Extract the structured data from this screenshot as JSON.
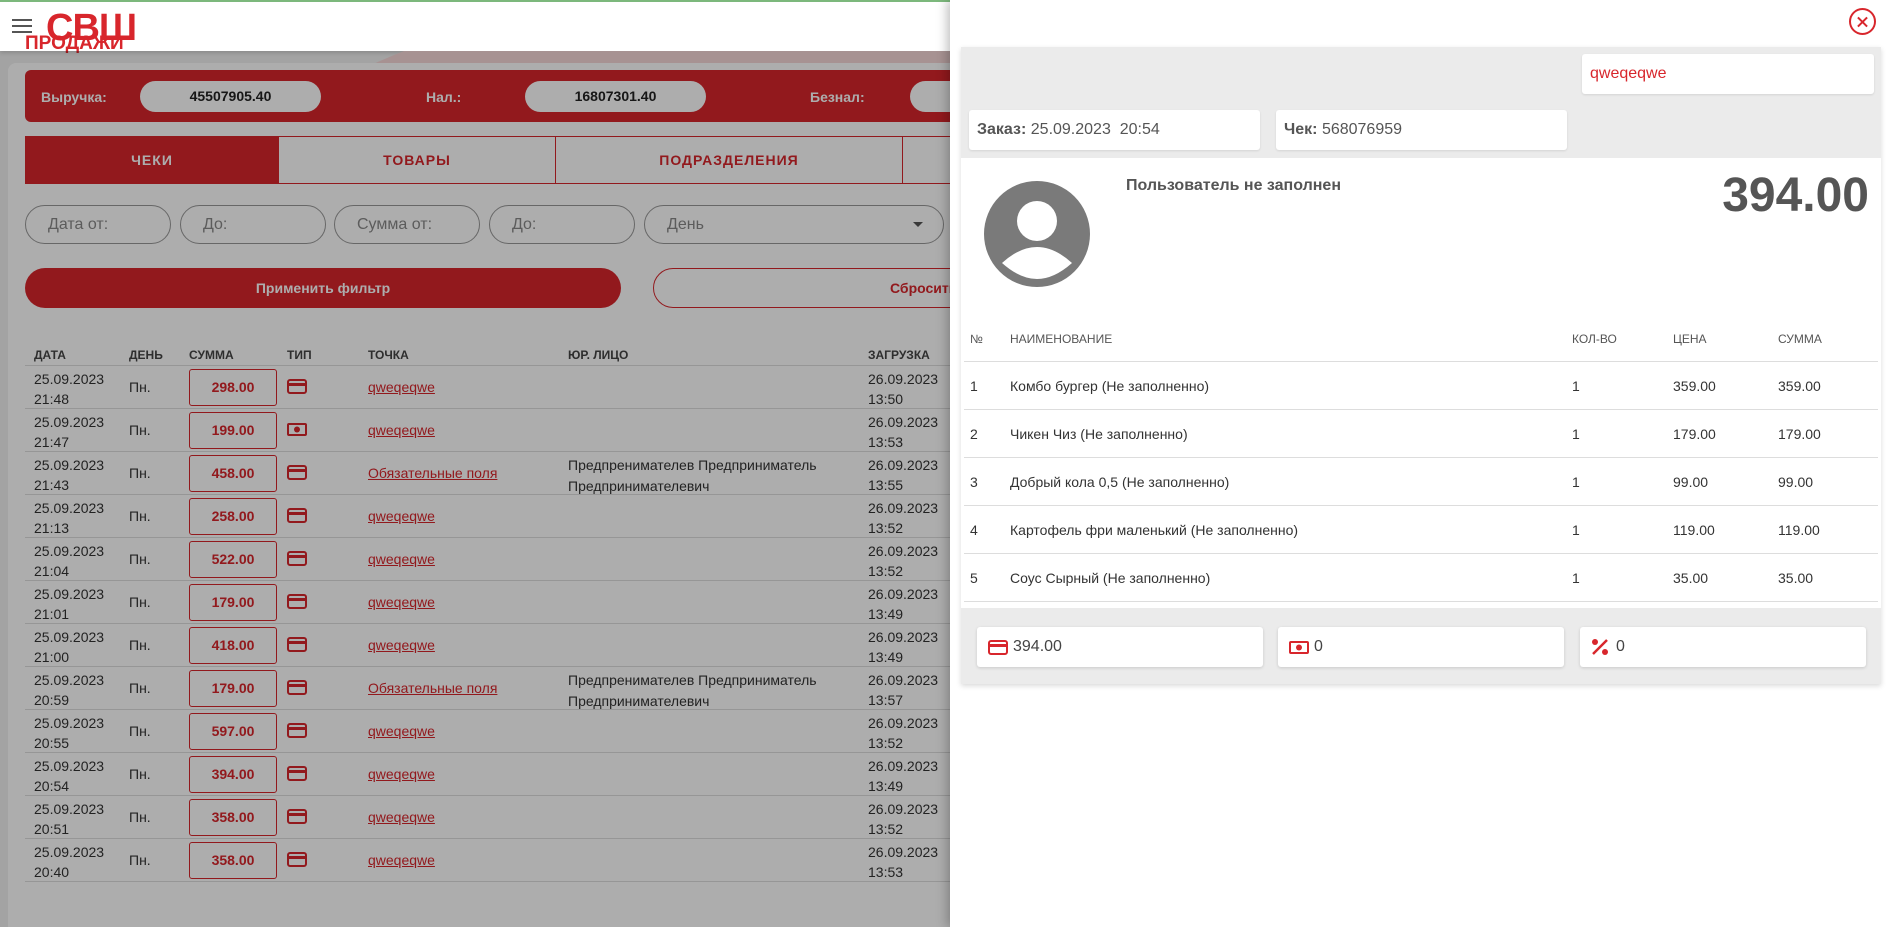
{
  "app": {
    "logo": "СВШ"
  },
  "page": {
    "title": "ПРОДАЖИ",
    "totals": [
      {
        "label": "Выручка:",
        "value": "45507905.40"
      },
      {
        "label": "Нал.:",
        "value": "16807301.40"
      },
      {
        "label": "Безнал:",
        "value": ""
      }
    ],
    "tabs": [
      "ЧЕКИ",
      "ТОВАРЫ",
      "ПОДРАЗДЕЛЕНИЯ"
    ],
    "filters": {
      "date_from": "Дата от:",
      "date_to": "До:",
      "sum_from": "Сумма от:",
      "sum_to": "До:",
      "period": "День"
    },
    "apply_label": "Применить фильтр",
    "reset_label": "Сбросить",
    "columns": {
      "date": "ДАТА",
      "day": "ДЕНЬ",
      "sum": "СУММА",
      "type": "ТИП",
      "point": "ТОЧКА",
      "legal": "ЮР. ЛИЦО",
      "load": "ЗАГРУЗКА"
    },
    "rows": [
      {
        "date1": "25.09.2023",
        "date2": "21:48",
        "day": "Пн.",
        "sum": "298.00",
        "type": "card",
        "point": "qweqeqwe",
        "legal1": "",
        "legal2": "",
        "load1": "26.09.2023",
        "load2": "13:50"
      },
      {
        "date1": "25.09.2023",
        "date2": "21:47",
        "day": "Пн.",
        "sum": "199.00",
        "type": "cash",
        "point": "qweqeqwe",
        "legal1": "",
        "legal2": "",
        "load1": "26.09.2023",
        "load2": "13:53"
      },
      {
        "date1": "25.09.2023",
        "date2": "21:43",
        "day": "Пн.",
        "sum": "458.00",
        "type": "card",
        "point": "Обязательные поля",
        "legal1": "Предпренимателев Предприниматель",
        "legal2": "Предпринимателевич",
        "load1": "26.09.2023",
        "load2": "13:55"
      },
      {
        "date1": "25.09.2023",
        "date2": "21:13",
        "day": "Пн.",
        "sum": "258.00",
        "type": "card",
        "point": "qweqeqwe",
        "legal1": "",
        "legal2": "",
        "load1": "26.09.2023",
        "load2": "13:52"
      },
      {
        "date1": "25.09.2023",
        "date2": "21:04",
        "day": "Пн.",
        "sum": "522.00",
        "type": "card",
        "point": "qweqeqwe",
        "legal1": "",
        "legal2": "",
        "load1": "26.09.2023",
        "load2": "13:52"
      },
      {
        "date1": "25.09.2023",
        "date2": "21:01",
        "day": "Пн.",
        "sum": "179.00",
        "type": "card",
        "point": "qweqeqwe",
        "legal1": "",
        "legal2": "",
        "load1": "26.09.2023",
        "load2": "13:49"
      },
      {
        "date1": "25.09.2023",
        "date2": "21:00",
        "day": "Пн.",
        "sum": "418.00",
        "type": "card",
        "point": "qweqeqwe",
        "legal1": "",
        "legal2": "",
        "load1": "26.09.2023",
        "load2": "13:49"
      },
      {
        "date1": "25.09.2023",
        "date2": "20:59",
        "day": "Пн.",
        "sum": "179.00",
        "type": "card",
        "point": "Обязательные поля",
        "legal1": "Предпренимателев Предприниматель",
        "legal2": "Предпринимателевич",
        "load1": "26.09.2023",
        "load2": "13:57"
      },
      {
        "date1": "25.09.2023",
        "date2": "20:55",
        "day": "Пн.",
        "sum": "597.00",
        "type": "card",
        "point": "qweqeqwe",
        "legal1": "",
        "legal2": "",
        "load1": "26.09.2023",
        "load2": "13:52"
      },
      {
        "date1": "25.09.2023",
        "date2": "20:54",
        "day": "Пн.",
        "sum": "394.00",
        "type": "card",
        "point": "qweqeqwe",
        "legal1": "",
        "legal2": "",
        "load1": "26.09.2023",
        "load2": "13:49"
      },
      {
        "date1": "25.09.2023",
        "date2": "20:51",
        "day": "Пн.",
        "sum": "358.00",
        "type": "card",
        "point": "qweqeqwe",
        "legal1": "",
        "legal2": "",
        "load1": "26.09.2023",
        "load2": "13:52"
      },
      {
        "date1": "25.09.2023",
        "date2": "20:40",
        "day": "Пн.",
        "sum": "358.00",
        "type": "card",
        "point": "qweqeqwe",
        "legal1": "",
        "legal2": "",
        "load1": "26.09.2023",
        "load2": "13:53"
      }
    ]
  },
  "receipt": {
    "point": "qweqeqwe",
    "order_label": "Заказ:",
    "order_value": "25.09.2023  20:54",
    "check_label": "Чек:",
    "check_value": "568076959",
    "user": "Пользователь не заполнен",
    "total": "394.00",
    "columns": {
      "n": "№",
      "name": "НАИМЕНОВАНИЕ",
      "qty": "КОЛ-ВО",
      "price": "ЦЕНА",
      "sum": "СУММА"
    },
    "items": [
      {
        "n": "1",
        "name": "Комбо бургер (Не заполненно)",
        "qty": "1",
        "price": "359.00",
        "sum": "359.00"
      },
      {
        "n": "2",
        "name": "Чикен Чиз (Не заполненно)",
        "qty": "1",
        "price": "179.00",
        "sum": "179.00"
      },
      {
        "n": "3",
        "name": "Добрый кола 0,5 (Не заполненно)",
        "qty": "1",
        "price": "99.00",
        "sum": "99.00"
      },
      {
        "n": "4",
        "name": "Картофель фри маленький (Не заполненно)",
        "qty": "1",
        "price": "119.00",
        "sum": "119.00"
      },
      {
        "n": "5",
        "name": "Соус Сырный (Не заполненно)",
        "qty": "1",
        "price": "35.00",
        "sum": "35.00"
      }
    ],
    "payments": {
      "card": "394.00",
      "cash": "0",
      "discount": "0"
    }
  },
  "colors": {
    "accent": "#d8262c",
    "text": "#555555"
  }
}
